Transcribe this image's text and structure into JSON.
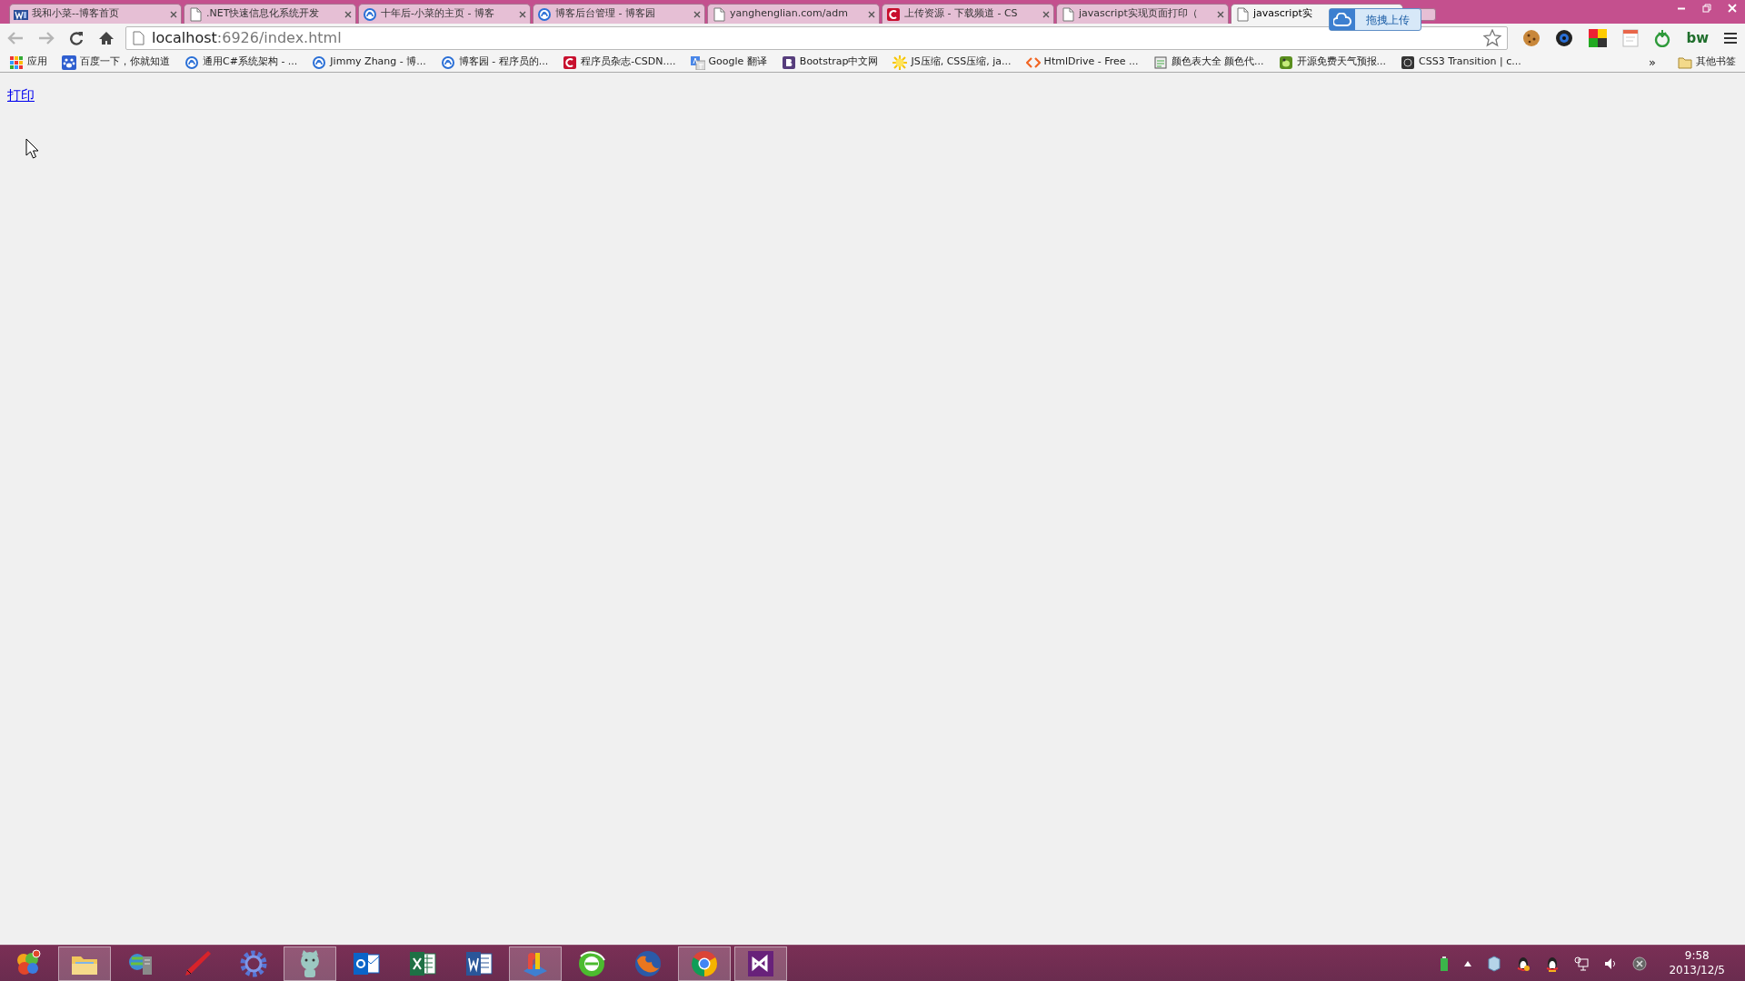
{
  "tabs": [
    {
      "title": "我和小菜--博客首页",
      "kind": "blog",
      "selected": false
    },
    {
      "title": ".NET快速信息化系统开发",
      "kind": "page",
      "selected": false
    },
    {
      "title": "十年后-小菜的主页 - 博客",
      "kind": "swirl",
      "selected": false
    },
    {
      "title": "博客后台管理 - 博客园",
      "kind": "swirl",
      "selected": false
    },
    {
      "title": "yanghenglian.com/adm",
      "kind": "page",
      "selected": false
    },
    {
      "title": "上传资源 - 下载频道 - CS",
      "kind": "arc",
      "selected": false
    },
    {
      "title": "javascript实现页面打印（",
      "kind": "page",
      "selected": false
    },
    {
      "title": "javascript实",
      "kind": "page",
      "selected": true
    }
  ],
  "upload_popup": {
    "label": "拖拽上传"
  },
  "toolbar": {
    "back": {
      "disabled": true
    },
    "forward": {
      "disabled": true
    },
    "address": {
      "host": "localhost",
      "path": ":6926/index.html"
    },
    "extension_text": "bw"
  },
  "bookmarks": [
    {
      "label": "应用",
      "kind": "apps"
    },
    {
      "label": "百度一下，你就知道",
      "kind": "paw"
    },
    {
      "label": "通用C#系统架构 - ...",
      "kind": "swirl"
    },
    {
      "label": "Jimmy Zhang - 博...",
      "kind": "swirl"
    },
    {
      "label": "博客园 - 程序员的...",
      "kind": "swirl"
    },
    {
      "label": "程序员杂志-CSDN....",
      "kind": "arc"
    },
    {
      "label": "Google 翻译",
      "kind": "translate"
    },
    {
      "label": "Bootstrap中文网",
      "kind": "square"
    },
    {
      "label": "JS压缩, CSS压缩, ja...",
      "kind": "sun"
    },
    {
      "label": "HtmlDrive - Free ...",
      "kind": "brackets"
    },
    {
      "label": "颜色表大全 颜色代...",
      "kind": "doc"
    },
    {
      "label": "开源免费天气预报...",
      "kind": "leaf"
    },
    {
      "label": "CSS3 Transition | c...",
      "kind": "dark"
    }
  ],
  "bookmarks_more": "»",
  "other_bookmarks": "其他书签",
  "content": {
    "link": "打印"
  },
  "taskbar": {
    "apps": [
      {
        "kind": "orb",
        "running": false
      },
      {
        "kind": "folder",
        "running": true
      },
      {
        "kind": "server",
        "running": false
      },
      {
        "kind": "pen",
        "running": false
      },
      {
        "kind": "gear",
        "running": false
      },
      {
        "kind": "cat",
        "running": true
      },
      {
        "kind": "mail",
        "running": false
      },
      {
        "kind": "sheet",
        "running": false
      },
      {
        "kind": "doc",
        "running": false
      },
      {
        "kind": "chart",
        "running": true
      },
      {
        "kind": "globe",
        "running": false
      },
      {
        "kind": "fox",
        "running": false
      },
      {
        "kind": "chrome",
        "running": true
      },
      {
        "kind": "studio",
        "running": true
      }
    ],
    "time": "9:58",
    "date": "2013/12/5"
  }
}
